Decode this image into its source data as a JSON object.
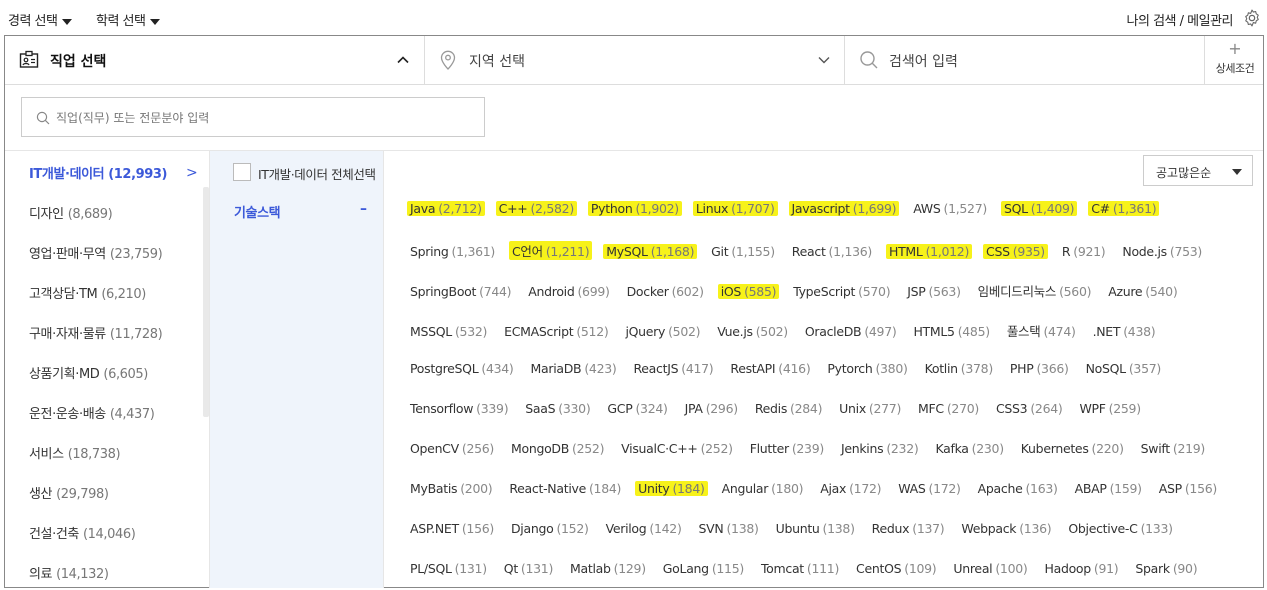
{
  "topbar": {
    "career_select": "경력 선택",
    "education_select": "학력 선택",
    "my_search": "나의 검색 / 메일관리"
  },
  "searchbar": {
    "job_select": "직업 선택",
    "region_select": "지역 선택",
    "keyword_input": "검색어 입력",
    "detail_plus": "+",
    "detail_label": "상세조건"
  },
  "job_search_placeholder": "직업(직무) 또는 전문분야 입력",
  "categories": [
    {
      "label": "IT개발·데이터",
      "count": "(12,993)"
    },
    {
      "label": "디자인",
      "count": "(8,689)"
    },
    {
      "label": "영업·판매·무역",
      "count": "(23,759)"
    },
    {
      "label": "고객상담·TM",
      "count": "(6,210)"
    },
    {
      "label": "구매·자재·물류",
      "count": "(11,728)"
    },
    {
      "label": "상품기획·MD",
      "count": "(6,605)"
    },
    {
      "label": "운전·운송·배송",
      "count": "(4,437)"
    },
    {
      "label": "서비스",
      "count": "(18,738)"
    },
    {
      "label": "생산",
      "count": "(29,798)"
    },
    {
      "label": "건설·건축",
      "count": "(14,046)"
    },
    {
      "label": "의료",
      "count": "(14,132)"
    }
  ],
  "active_category_arrow": ">",
  "subcategory": {
    "label": "기술스택",
    "toggle": "–"
  },
  "select_all_label": "IT개발·데이터 전체선택",
  "sort": {
    "selected": "공고많은순"
  },
  "highlight_color": "#f7f21a",
  "accent_color": "#3c59d9",
  "tech_rows": [
    [
      {
        "name": "Java",
        "count": "(2,712)",
        "hl": true
      },
      {
        "name": "C++",
        "count": "(2,582)",
        "hl": true
      },
      {
        "name": "Python",
        "count": "(1,902)",
        "hl": true
      },
      {
        "name": "Linux",
        "count": "(1,707)",
        "hl": true
      },
      {
        "name": "Javascript",
        "count": "(1,699)",
        "hl": true
      },
      {
        "name": "AWS",
        "count": "(1,527)",
        "hl": false
      },
      {
        "name": "SQL",
        "count": "(1,409)",
        "hl": true
      },
      {
        "name": "C#",
        "count": "(1,361)",
        "hl": true
      }
    ],
    [
      {
        "name": "Spring",
        "count": "(1,361)",
        "hl": false
      },
      {
        "name": "C언어",
        "count": "(1,211)",
        "hl": true
      },
      {
        "name": "MySQL",
        "count": "(1,168)",
        "hl": true
      },
      {
        "name": "Git",
        "count": "(1,155)",
        "hl": false
      },
      {
        "name": "React",
        "count": "(1,136)",
        "hl": false
      },
      {
        "name": "HTML",
        "count": "(1,012)",
        "hl": true
      },
      {
        "name": "CSS",
        "count": "(935)",
        "hl": true
      },
      {
        "name": "R",
        "count": "(921)",
        "hl": false
      },
      {
        "name": "Node.js",
        "count": "(753)",
        "hl": false
      }
    ],
    [
      {
        "name": "SpringBoot",
        "count": "(744)",
        "hl": false
      },
      {
        "name": "Android",
        "count": "(699)",
        "hl": false
      },
      {
        "name": "Docker",
        "count": "(602)",
        "hl": false
      },
      {
        "name": "iOS",
        "count": "(585)",
        "hl": true
      },
      {
        "name": "TypeScript",
        "count": "(570)",
        "hl": false
      },
      {
        "name": "JSP",
        "count": "(563)",
        "hl": false
      },
      {
        "name": "임베디드리눅스",
        "count": "(560)",
        "hl": false
      },
      {
        "name": "Azure",
        "count": "(540)",
        "hl": false
      }
    ],
    [
      {
        "name": "MSSQL",
        "count": "(532)",
        "hl": false
      },
      {
        "name": "ECMAScript",
        "count": "(512)",
        "hl": false
      },
      {
        "name": "jQuery",
        "count": "(502)",
        "hl": false
      },
      {
        "name": "Vue.js",
        "count": "(502)",
        "hl": false
      },
      {
        "name": "OracleDB",
        "count": "(497)",
        "hl": false
      },
      {
        "name": "HTML5",
        "count": "(485)",
        "hl": false
      },
      {
        "name": "풀스택",
        "count": "(474)",
        "hl": false
      },
      {
        "name": ".NET",
        "count": "(438)",
        "hl": false
      }
    ],
    [
      {
        "name": "PostgreSQL",
        "count": "(434)",
        "hl": false
      },
      {
        "name": "MariaDB",
        "count": "(423)",
        "hl": false
      },
      {
        "name": "ReactJS",
        "count": "(417)",
        "hl": false
      },
      {
        "name": "RestAPI",
        "count": "(416)",
        "hl": false
      },
      {
        "name": "Pytorch",
        "count": "(380)",
        "hl": false
      },
      {
        "name": "Kotlin",
        "count": "(378)",
        "hl": false
      },
      {
        "name": "PHP",
        "count": "(366)",
        "hl": false
      },
      {
        "name": "NoSQL",
        "count": "(357)",
        "hl": false
      }
    ],
    [
      {
        "name": "Tensorflow",
        "count": "(339)",
        "hl": false
      },
      {
        "name": "SaaS",
        "count": "(330)",
        "hl": false
      },
      {
        "name": "GCP",
        "count": "(324)",
        "hl": false
      },
      {
        "name": "JPA",
        "count": "(296)",
        "hl": false
      },
      {
        "name": "Redis",
        "count": "(284)",
        "hl": false
      },
      {
        "name": "Unix",
        "count": "(277)",
        "hl": false
      },
      {
        "name": "MFC",
        "count": "(270)",
        "hl": false
      },
      {
        "name": "CSS3",
        "count": "(264)",
        "hl": false
      },
      {
        "name": "WPF",
        "count": "(259)",
        "hl": false
      }
    ],
    [
      {
        "name": "OpenCV",
        "count": "(256)",
        "hl": false
      },
      {
        "name": "MongoDB",
        "count": "(252)",
        "hl": false
      },
      {
        "name": "VisualC·C++",
        "count": "(252)",
        "hl": false
      },
      {
        "name": "Flutter",
        "count": "(239)",
        "hl": false
      },
      {
        "name": "Jenkins",
        "count": "(232)",
        "hl": false
      },
      {
        "name": "Kafka",
        "count": "(230)",
        "hl": false
      },
      {
        "name": "Kubernetes",
        "count": "(220)",
        "hl": false
      },
      {
        "name": "Swift",
        "count": "(219)",
        "hl": false
      }
    ],
    [
      {
        "name": "MyBatis",
        "count": "(200)",
        "hl": false
      },
      {
        "name": "React-Native",
        "count": "(184)",
        "hl": false
      },
      {
        "name": "Unity",
        "count": "(184)",
        "hl": true
      },
      {
        "name": "Angular",
        "count": "(180)",
        "hl": false
      },
      {
        "name": "Ajax",
        "count": "(172)",
        "hl": false
      },
      {
        "name": "WAS",
        "count": "(172)",
        "hl": false
      },
      {
        "name": "Apache",
        "count": "(163)",
        "hl": false
      },
      {
        "name": "ABAP",
        "count": "(159)",
        "hl": false
      },
      {
        "name": "ASP",
        "count": "(156)",
        "hl": false
      }
    ],
    [
      {
        "name": "ASP.NET",
        "count": "(156)",
        "hl": false
      },
      {
        "name": "Django",
        "count": "(152)",
        "hl": false
      },
      {
        "name": "Verilog",
        "count": "(142)",
        "hl": false
      },
      {
        "name": "SVN",
        "count": "(138)",
        "hl": false
      },
      {
        "name": "Ubuntu",
        "count": "(138)",
        "hl": false
      },
      {
        "name": "Redux",
        "count": "(137)",
        "hl": false
      },
      {
        "name": "Webpack",
        "count": "(136)",
        "hl": false
      },
      {
        "name": "Objective-C",
        "count": "(133)",
        "hl": false
      }
    ],
    [
      {
        "name": "PL/SQL",
        "count": "(131)",
        "hl": false
      },
      {
        "name": "Qt",
        "count": "(131)",
        "hl": false
      },
      {
        "name": "Matlab",
        "count": "(129)",
        "hl": false
      },
      {
        "name": "GoLang",
        "count": "(115)",
        "hl": false
      },
      {
        "name": "Tomcat",
        "count": "(111)",
        "hl": false
      },
      {
        "name": "CentOS",
        "count": "(109)",
        "hl": false
      },
      {
        "name": "Unreal",
        "count": "(100)",
        "hl": false
      },
      {
        "name": "Hadoop",
        "count": "(91)",
        "hl": false
      },
      {
        "name": "Spark",
        "count": "(90)",
        "hl": false
      }
    ]
  ]
}
